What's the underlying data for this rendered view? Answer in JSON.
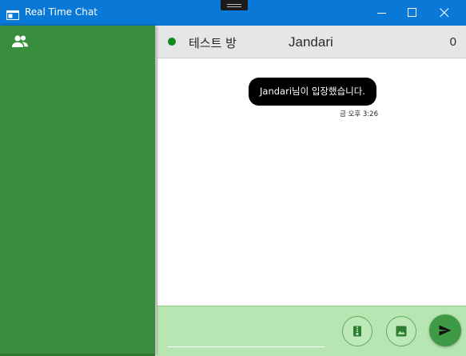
{
  "window": {
    "title": "Real Time Chat",
    "icons": {
      "app": "app-window-icon",
      "minimize": "minimize-icon",
      "maximize": "maximize-icon",
      "close": "close-icon"
    }
  },
  "sidebar": {
    "icon": "people-icon",
    "background_color": "#388e3c"
  },
  "header": {
    "room_name": "테스트 방",
    "user_name": "Jandari",
    "user_count": "0",
    "status_color": "#0f8a1f"
  },
  "messages": [
    {
      "type": "system",
      "text": "Jandari님이 입장했습니다.",
      "time": "금 오후 3:26"
    }
  ],
  "composer": {
    "value": "",
    "buttons": {
      "file": "file-icon",
      "image": "image-icon",
      "send": "send-icon"
    },
    "accent_color": "#3f9a45"
  }
}
